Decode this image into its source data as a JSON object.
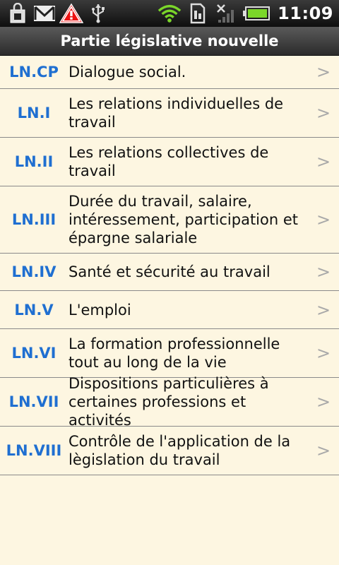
{
  "status_bar": {
    "time": "11:09",
    "icons_left": [
      "lock-bag-icon",
      "gmail-icon",
      "warning-icon",
      "usb-icon"
    ],
    "icons_right": [
      "wifi-icon",
      "sim-icon",
      "no-signal-icon",
      "battery-icon"
    ]
  },
  "header": {
    "title": "Partie législative nouvelle"
  },
  "items": [
    {
      "code": "LN.CP",
      "label": "Dialogue social."
    },
    {
      "code": "LN.I",
      "label": "Les relations individuelles de travail"
    },
    {
      "code": "LN.II",
      "label": "Les relations collectives de travail"
    },
    {
      "code": "LN.III",
      "label": "Durée du travail, salaire, intéressement, participation et épargne salariale"
    },
    {
      "code": "LN.IV",
      "label": "Santé et sécurité au travail"
    },
    {
      "code": "LN.V",
      "label": "L'emploi"
    },
    {
      "code": "LN.VI",
      "label": "La formation professionnelle tout au long de la vie"
    },
    {
      "code": "LN.VII",
      "label": "Dispositions particulières à certaines professions et activités"
    },
    {
      "code": "LN.VIII",
      "label": "Contrôle de l'application de la lègislation du travail"
    }
  ],
  "chevron": ">"
}
